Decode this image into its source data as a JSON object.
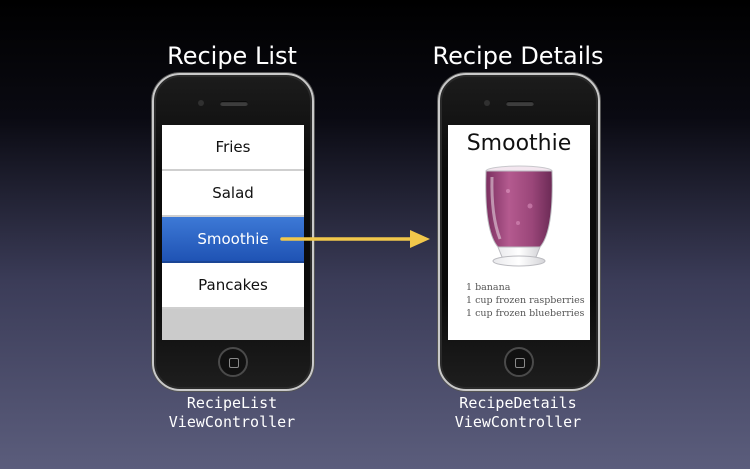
{
  "left": {
    "title": "Recipe List",
    "rows": [
      "Fries",
      "Salad",
      "Smoothie",
      "Pancakes"
    ],
    "selected_index": 2,
    "caption_line1": "RecipeList",
    "caption_line2": "ViewController"
  },
  "right": {
    "title": "Recipe Details",
    "recipe_name": "Smoothie",
    "ingredients": [
      "1 banana",
      "1 cup frozen raspberries",
      "1 cup frozen blueberries"
    ],
    "caption_line1": "RecipeDetails",
    "caption_line2": "ViewController"
  },
  "colors": {
    "selection": "#2a62c6",
    "arrow": "#f2c84b",
    "smoothie": "#9b4a7e"
  },
  "icons": [
    "arrow-right-icon",
    "home-button-icon",
    "smoothie-glass-image"
  ]
}
